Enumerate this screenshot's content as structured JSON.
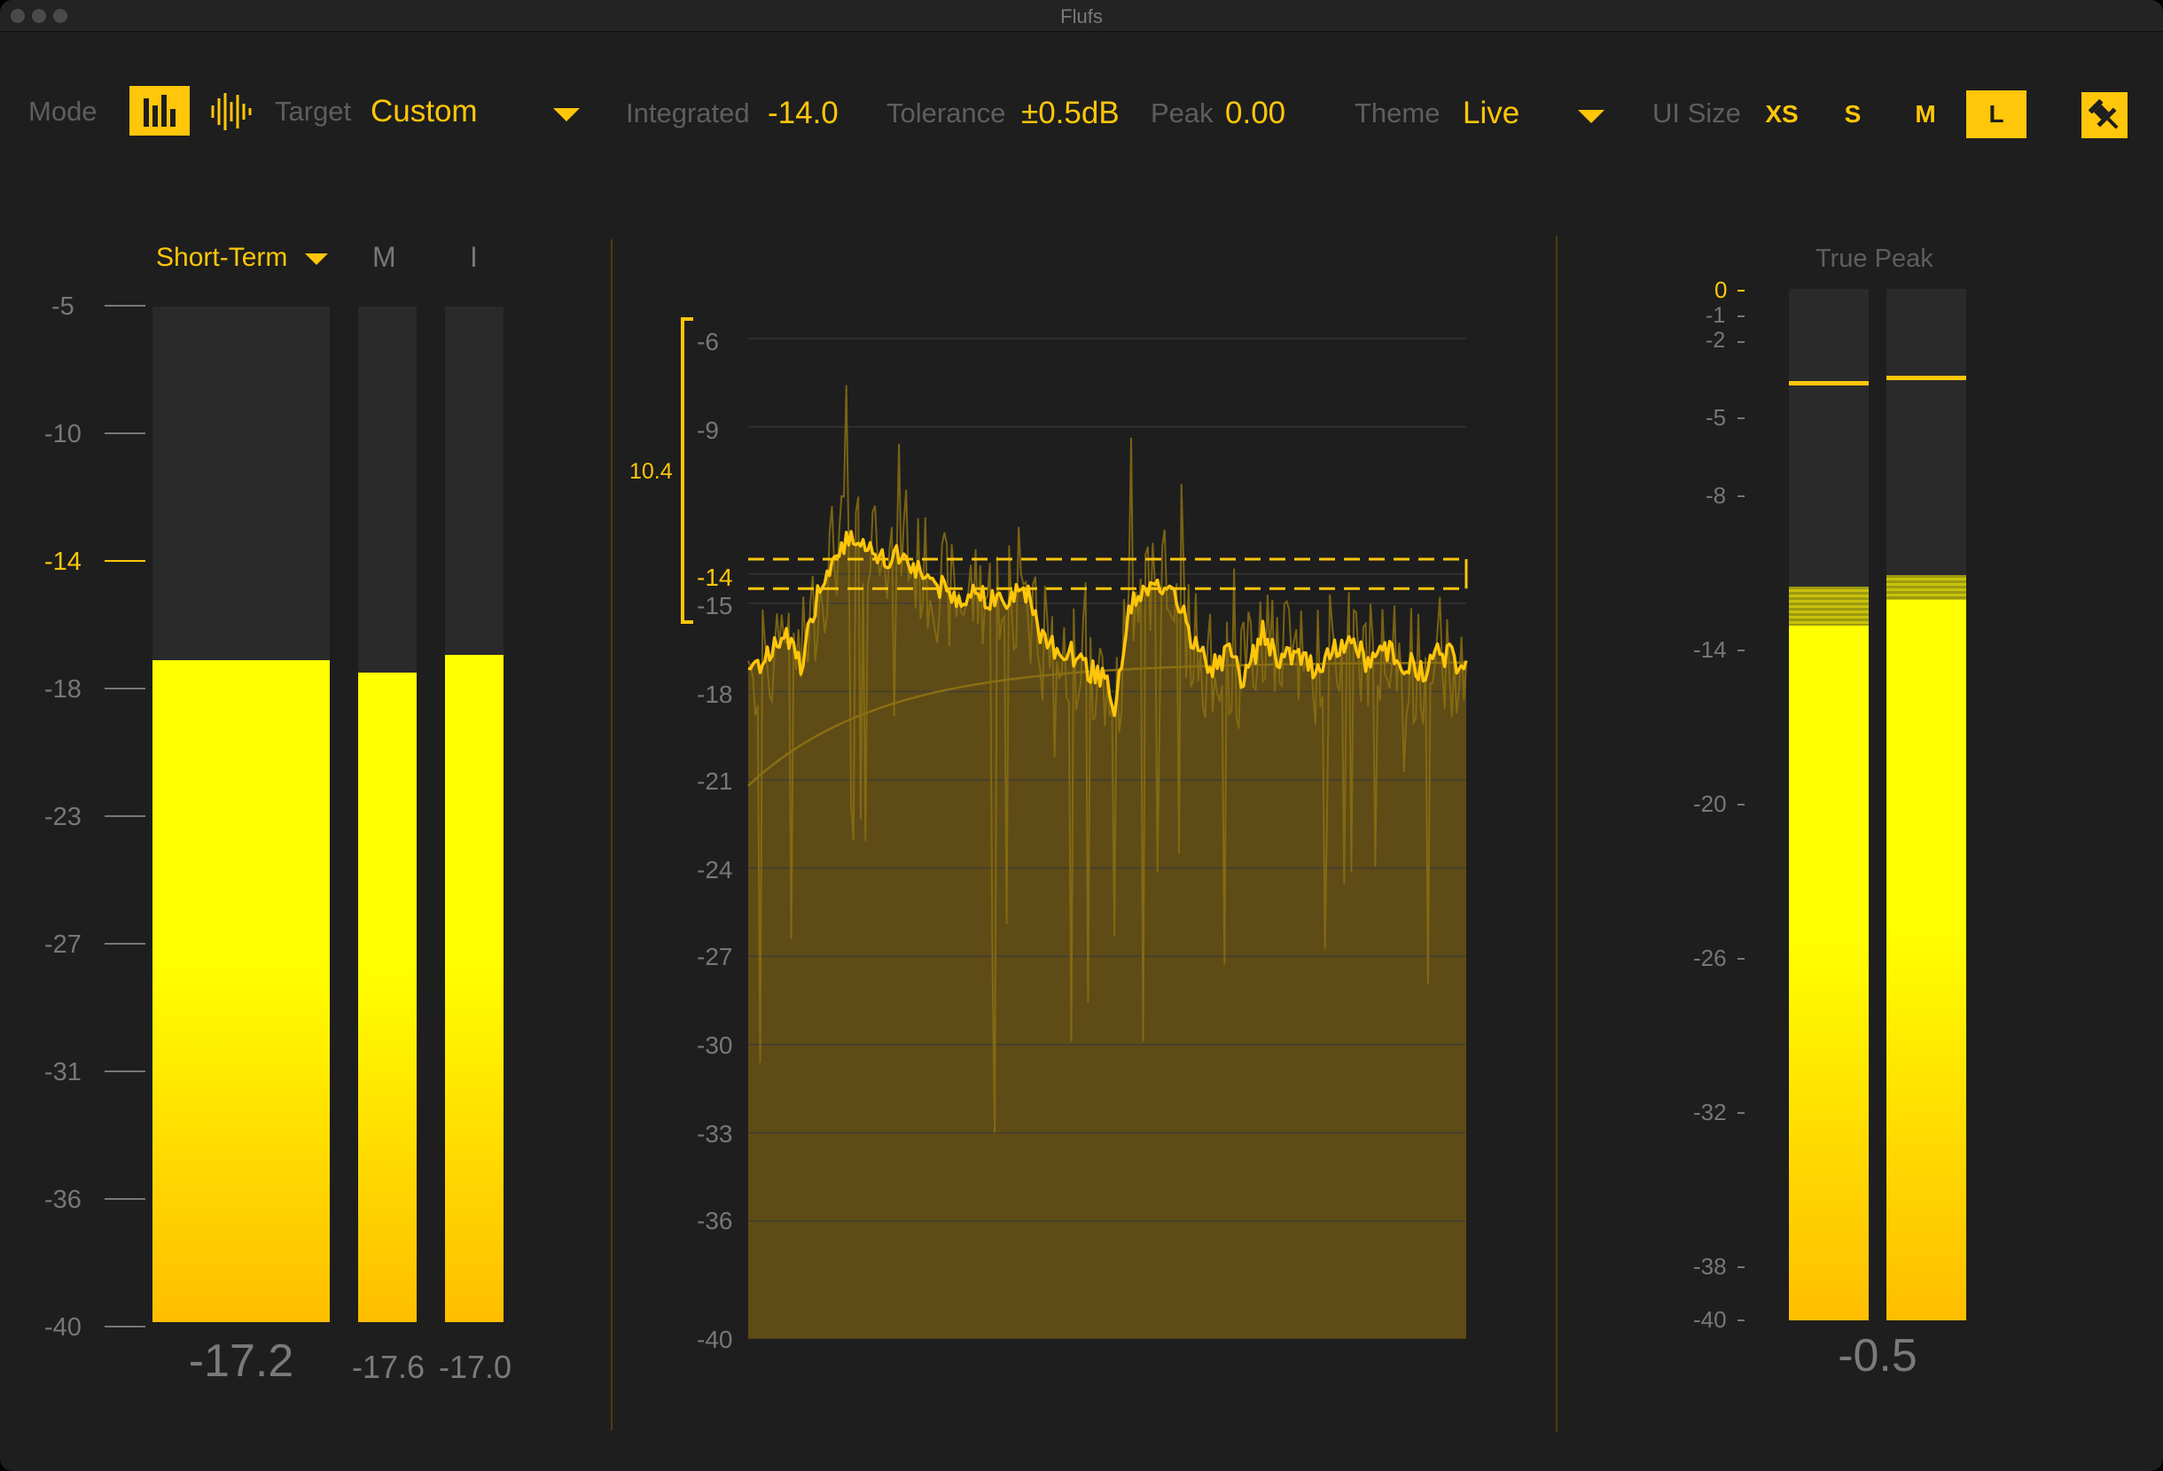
{
  "window": {
    "title": "Flufs"
  },
  "toolbar": {
    "mode_label": "Mode",
    "mode_buttons": [
      {
        "icon": "bar-meter-icon",
        "active": true
      },
      {
        "icon": "waveform-icon",
        "active": false
      }
    ],
    "target_label": "Target",
    "target_value": "Custom",
    "integrated_label": "Integrated",
    "integrated_value": "-14.0",
    "tolerance_label": "Tolerance",
    "tolerance_value": "±0.5dB",
    "peak_label": "Peak",
    "peak_value": "0.00",
    "theme_label": "Theme",
    "theme_value": "Live",
    "ui_size_label": "UI Size",
    "ui_sizes": [
      "XS",
      "S",
      "M",
      "L"
    ],
    "ui_size_selected": "L",
    "pin_icon": "pin-icon"
  },
  "loudness_meters": {
    "mode_select": "Short-Term",
    "col_labels": [
      "M",
      "I"
    ],
    "scale": [
      "-5",
      "-10",
      "-14",
      "-18",
      "-23",
      "-27",
      "-31",
      "-36",
      "-40"
    ],
    "highlight_tick": "-14",
    "short_term_value": "-17.2",
    "momentary_value": "-17.6",
    "integrated_value": "-17.0",
    "short_term_level": -17.2,
    "momentary_level": -17.6,
    "integrated_level": -17.0
  },
  "history_graph": {
    "scale": [
      "-6",
      "-9",
      "-15",
      "-18",
      "-21",
      "-24",
      "-27",
      "-30",
      "-33",
      "-36",
      "-40"
    ],
    "target_tick": "-14",
    "range_label": "10.4",
    "range_top": -5.0,
    "range_bottom": -15.4,
    "tolerance_band": [
      -13.5,
      -14.5
    ],
    "accent": "#ffc60a",
    "fill_color": "#5e4b16"
  },
  "true_peak": {
    "title": "True Peak",
    "scale": [
      "0",
      "-1",
      "-2",
      "-5",
      "-8",
      "-14",
      "-20",
      "-26",
      "-32",
      "-38",
      "-40"
    ],
    "highlight_tick": "0",
    "value": "-0.5",
    "left_level": -13.1,
    "right_level": -12.1,
    "left_hold": -3.6,
    "right_hold": -3.4
  },
  "colors": {
    "accent": "#ffc60a",
    "background": "#1e1e1e",
    "meter_yellow": "#ffff00"
  }
}
